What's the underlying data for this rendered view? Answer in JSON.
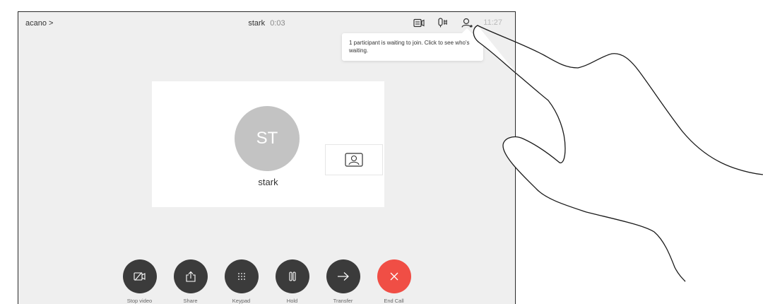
{
  "header": {
    "breadcrumb": "acano >",
    "call_name": "stark",
    "call_duration": "0:03",
    "clock": "11:27"
  },
  "tooltip": {
    "text": "1 participant is waiting to join. Click to see who's waiting."
  },
  "participant": {
    "initials": "ST",
    "name": "stark"
  },
  "icons": {
    "layout": "layout-icon",
    "mic": "microphone-icon",
    "participants": "participants-icon",
    "selfview": "selfview-icon"
  },
  "controls": [
    {
      "label": "Stop video",
      "icon": "camera-off-icon"
    },
    {
      "label": "Share",
      "icon": "share-icon"
    },
    {
      "label": "Keypad",
      "icon": "keypad-icon"
    },
    {
      "label": "Hold",
      "icon": "pause-icon"
    },
    {
      "label": "Transfer",
      "icon": "arrow-right-icon"
    },
    {
      "label": "End Call",
      "icon": "close-icon"
    }
  ],
  "colors": {
    "end_call": "#f04e45",
    "control": "#3b3b3b",
    "screen_bg": "#efefef"
  }
}
